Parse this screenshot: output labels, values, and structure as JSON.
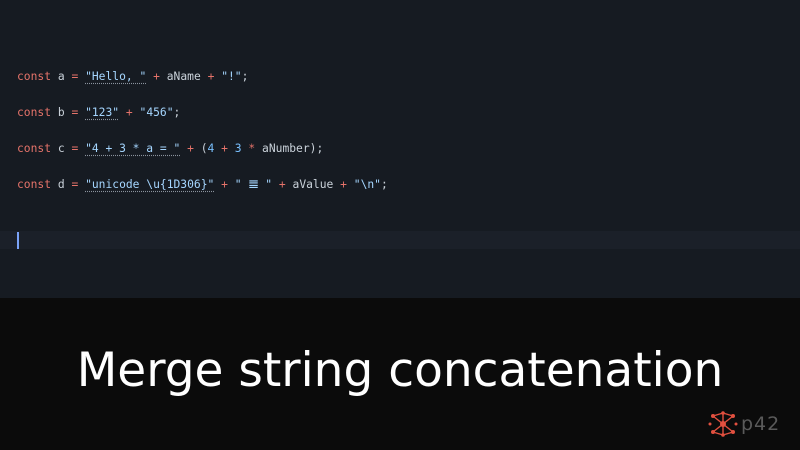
{
  "editor": {
    "lines": [
      {
        "tokens": [
          {
            "t": "const",
            "c": "kw"
          },
          {
            "t": " ",
            "c": "pun"
          },
          {
            "t": "a",
            "c": "id"
          },
          {
            "t": " ",
            "c": "pun"
          },
          {
            "t": "=",
            "c": "op"
          },
          {
            "t": " ",
            "c": "pun"
          },
          {
            "t": "\"Hello, \"",
            "c": "str hint"
          },
          {
            "t": " ",
            "c": "pun"
          },
          {
            "t": "+",
            "c": "op"
          },
          {
            "t": " ",
            "c": "pun"
          },
          {
            "t": "aName",
            "c": "id"
          },
          {
            "t": " ",
            "c": "pun"
          },
          {
            "t": "+",
            "c": "op"
          },
          {
            "t": " ",
            "c": "pun"
          },
          {
            "t": "\"!\"",
            "c": "str"
          },
          {
            "t": ";",
            "c": "pun"
          }
        ]
      },
      {
        "tokens": [
          {
            "t": "const",
            "c": "kw"
          },
          {
            "t": " ",
            "c": "pun"
          },
          {
            "t": "b",
            "c": "id"
          },
          {
            "t": " ",
            "c": "pun"
          },
          {
            "t": "=",
            "c": "op"
          },
          {
            "t": " ",
            "c": "pun"
          },
          {
            "t": "\"123\"",
            "c": "str hint"
          },
          {
            "t": " ",
            "c": "pun"
          },
          {
            "t": "+",
            "c": "op"
          },
          {
            "t": " ",
            "c": "pun"
          },
          {
            "t": "\"456\"",
            "c": "str"
          },
          {
            "t": ";",
            "c": "pun"
          }
        ]
      },
      {
        "tokens": [
          {
            "t": "const",
            "c": "kw"
          },
          {
            "t": " ",
            "c": "pun"
          },
          {
            "t": "c",
            "c": "id"
          },
          {
            "t": " ",
            "c": "pun"
          },
          {
            "t": "=",
            "c": "op"
          },
          {
            "t": " ",
            "c": "pun"
          },
          {
            "t": "\"4 + 3 * a = \"",
            "c": "str hint"
          },
          {
            "t": " ",
            "c": "pun"
          },
          {
            "t": "+",
            "c": "op"
          },
          {
            "t": " ",
            "c": "pun"
          },
          {
            "t": "(",
            "c": "pun"
          },
          {
            "t": "4",
            "c": "num"
          },
          {
            "t": " ",
            "c": "pun"
          },
          {
            "t": "+",
            "c": "op"
          },
          {
            "t": " ",
            "c": "pun"
          },
          {
            "t": "3",
            "c": "num"
          },
          {
            "t": " ",
            "c": "pun"
          },
          {
            "t": "*",
            "c": "op"
          },
          {
            "t": " ",
            "c": "pun"
          },
          {
            "t": "aNumber",
            "c": "id"
          },
          {
            "t": ");",
            "c": "pun"
          }
        ]
      },
      {
        "tokens": [
          {
            "t": "const",
            "c": "kw"
          },
          {
            "t": " ",
            "c": "pun"
          },
          {
            "t": "d",
            "c": "id"
          },
          {
            "t": " ",
            "c": "pun"
          },
          {
            "t": "=",
            "c": "op"
          },
          {
            "t": " ",
            "c": "pun"
          },
          {
            "t": "\"unicode \\u{1D306}\"",
            "c": "str hint"
          },
          {
            "t": " ",
            "c": "pun"
          },
          {
            "t": "+",
            "c": "op"
          },
          {
            "t": " ",
            "c": "pun"
          },
          {
            "t": "\" 𝌆 \"",
            "c": "str"
          },
          {
            "t": " ",
            "c": "pun"
          },
          {
            "t": "+",
            "c": "op"
          },
          {
            "t": " ",
            "c": "pun"
          },
          {
            "t": "aValue",
            "c": "id"
          },
          {
            "t": " ",
            "c": "pun"
          },
          {
            "t": "+",
            "c": "op"
          },
          {
            "t": " ",
            "c": "pun"
          },
          {
            "t": "\"\\n\"",
            "c": "str"
          },
          {
            "t": ";",
            "c": "pun"
          }
        ]
      }
    ]
  },
  "caption": {
    "title": "Merge string concatenation"
  },
  "logo": {
    "text": "p42",
    "icon": "network-logo-icon",
    "icon_color": "#e2503f"
  },
  "colors": {
    "editor_bg": "#161b22",
    "caption_bg": "#0b0b0b",
    "keyword": "#e5736a",
    "string": "#a5d6ff",
    "cursor": "#7aa2f7"
  }
}
